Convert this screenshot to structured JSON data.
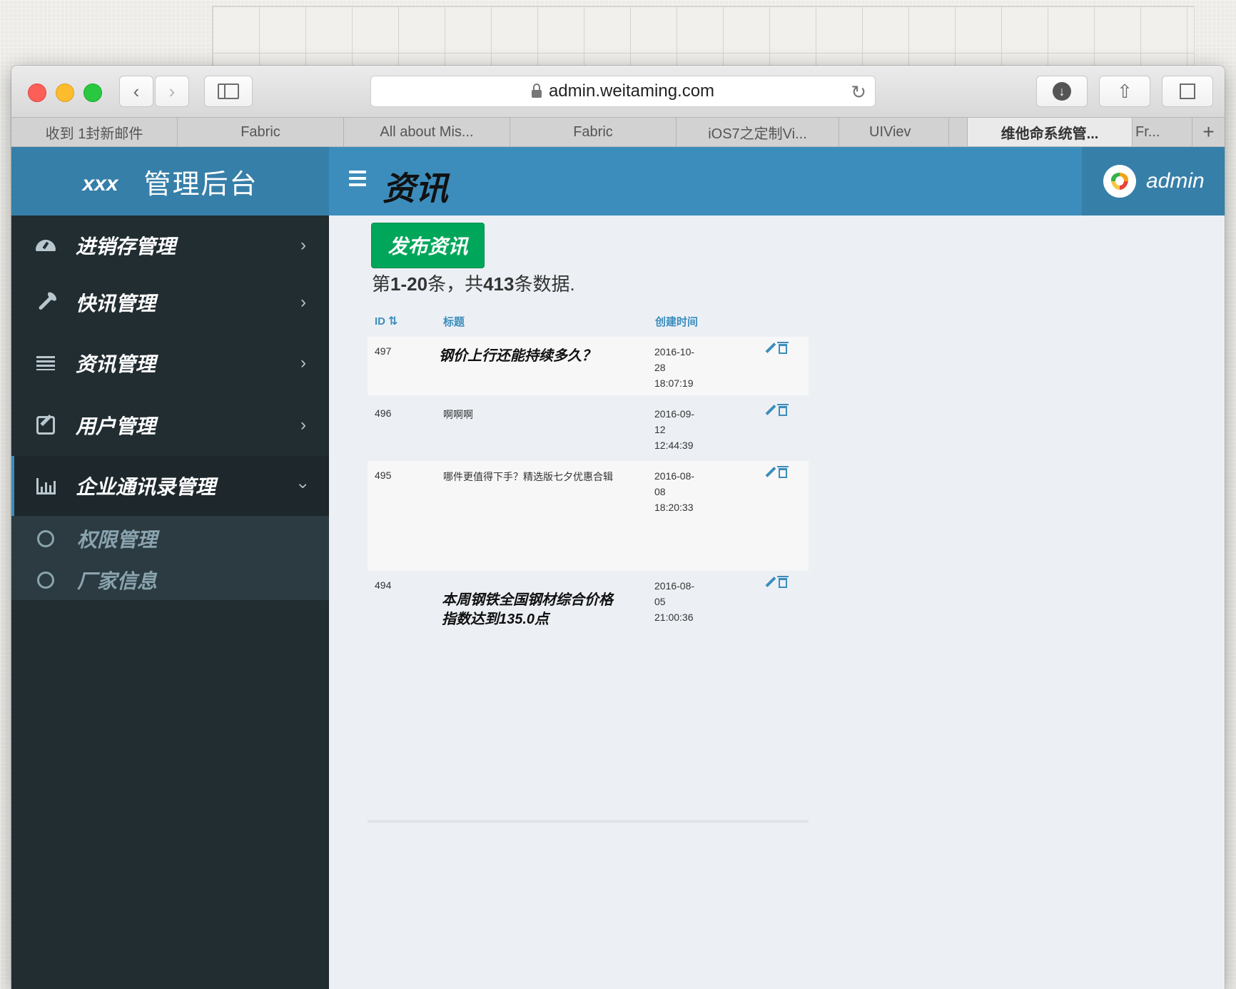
{
  "browser": {
    "url": "admin.weitaming.com",
    "tabs": [
      {
        "label": "收到 1封新邮件",
        "active": false
      },
      {
        "label": "Fabric",
        "active": false
      },
      {
        "label": "All about Mis...",
        "active": false
      },
      {
        "label": "Fabric",
        "active": false
      },
      {
        "label": "iOS7之定制Vi...",
        "active": false
      },
      {
        "label": "UIViev",
        "active": false
      },
      {
        "label": "",
        "active": false
      },
      {
        "label": "维他命系统管...",
        "active": true
      },
      {
        "label": "Fr...",
        "active": false
      },
      {
        "label": "+",
        "active": false
      }
    ]
  },
  "header": {
    "logo_mini": "xxx",
    "logo_title": "管理后台",
    "user_name": "admin"
  },
  "sidebar": {
    "items": [
      {
        "label": "进销存管理",
        "icon": "dashboard-icon"
      },
      {
        "label": "快讯管理",
        "icon": "wrench-icon"
      },
      {
        "label": "资讯管理",
        "icon": "list-icon"
      },
      {
        "label": "用户管理",
        "icon": "edit-icon"
      },
      {
        "label": "企业通讯录管理",
        "icon": "bar-chart-icon"
      }
    ],
    "subitems": [
      {
        "label": "权限管理"
      },
      {
        "label": "厂家信息"
      }
    ]
  },
  "content": {
    "title": "资讯",
    "publish_button": "发布资讯",
    "summary": {
      "prefix": "第",
      "range": "1-20",
      "middle": "条，共",
      "total": "413",
      "suffix": "条数据."
    }
  },
  "table": {
    "headers": {
      "id": "ID",
      "title": "标题",
      "created": "创建时间"
    },
    "rows": [
      {
        "id": "497",
        "title": "钢价上行还能持续多久？",
        "date": "2016-10-",
        "day": "28",
        "time": "18:07:19"
      },
      {
        "id": "496",
        "title": "啊啊啊",
        "date": "2016-09-",
        "day": "12",
        "time": "12:44:39"
      },
      {
        "id": "495",
        "title": "哪件更值得下手？精选版七夕优惠合辑",
        "date": "2016-08-",
        "day": "08",
        "time": "18:20:33"
      },
      {
        "id": "494",
        "title_line1": "本周钢铁全国钢材综合价格",
        "title_line2": "指数达到135.0点",
        "date": "2016-08-",
        "day": "05",
        "time": "21:00:36"
      }
    ]
  },
  "colors": {
    "header": "#3c8dbc",
    "header_dark": "#367fa9",
    "sidebar": "#222d32",
    "success": "#00a65a"
  }
}
